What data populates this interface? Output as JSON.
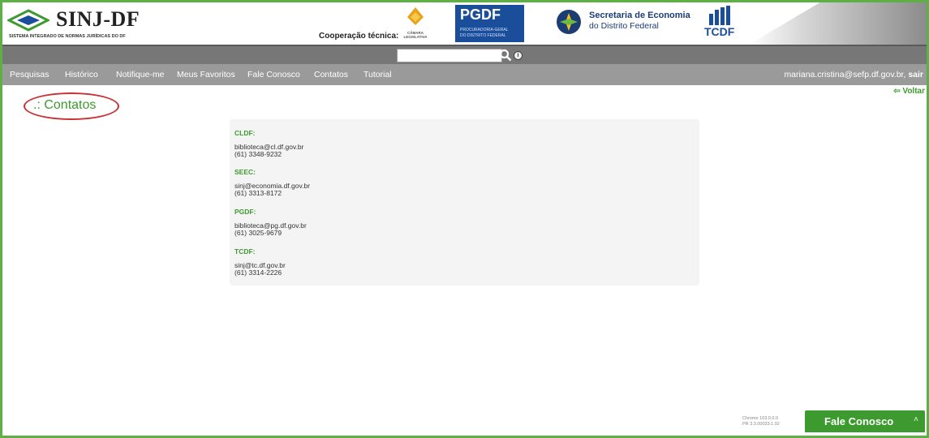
{
  "header": {
    "logo_name": "SINJ-DF",
    "logo_subtitle": "SISTEMA INTEGRADO DE NORMAS JURÍDICAS DO DF",
    "cooperation_label": "Cooperação técnica:",
    "camara_label": "CÂMARA LEGISLATIVA",
    "pgdf_title": "PGDF",
    "pgdf_sub1": "PROCURADORIA-GERAL",
    "pgdf_sub2": "DO DISTRITO FEDERAL",
    "seec_line1": "Secretaria de Economia",
    "seec_line2": "do Distrito Federal",
    "tcdf_label": "TCDF"
  },
  "search": {
    "placeholder": ""
  },
  "nav": {
    "items": [
      "Pesquisas",
      "Histórico",
      "Notifique-me",
      "Meus Favoritos",
      "Fale Conosco",
      "Contatos",
      "Tutorial"
    ],
    "user_email": "mariana.cristina@sefp.df.gov.br,",
    "logout": "sair"
  },
  "page": {
    "back": "Voltar",
    "title": ".: Contatos"
  },
  "contacts": [
    {
      "org": "CLDF:",
      "email": "biblioteca@cl.df.gov.br",
      "phone": "(61) 3348-9232"
    },
    {
      "org": "SEEC:",
      "email": "sinj@economia.df.gov.br",
      "phone": "(61) 3313-8172"
    },
    {
      "org": "PGDF:",
      "email": "biblioteca@pg.df.gov.br",
      "phone": "(61) 3025-9679"
    },
    {
      "org": "TCDF:",
      "email": "sinj@tc.df.gov.br",
      "phone": "(61) 3314-2226"
    }
  ],
  "footer": {
    "browser": "Chrome 103.0.0.0",
    "version": "PR 3.3.00033.1.92",
    "fale_conosco": "Fale Conosco"
  },
  "colors": {
    "accent": "#3c9a2e",
    "frame": "#5db043",
    "nav": "#9a9a9a",
    "highlight": "#c83232"
  }
}
